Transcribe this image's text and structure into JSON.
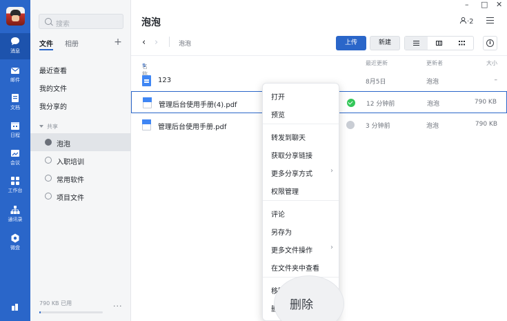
{
  "rail": {
    "items": [
      {
        "label": "消息",
        "icon": "chat-bubble-icon"
      },
      {
        "label": "邮件",
        "icon": "mail-icon"
      },
      {
        "label": "文档",
        "icon": "document-icon"
      },
      {
        "label": "日程",
        "icon": "calendar-icon"
      },
      {
        "label": "会议",
        "icon": "meeting-icon"
      },
      {
        "label": "工作台",
        "icon": "workbench-icon"
      },
      {
        "label": "通讯录",
        "icon": "contacts-icon"
      },
      {
        "label": "微盘",
        "icon": "drive-icon"
      }
    ]
  },
  "sidebar": {
    "search_placeholder": "搜索",
    "tabs": [
      "文件",
      "相册"
    ],
    "add": "+",
    "links": [
      "最近查看",
      "我的文件",
      "我分享的"
    ],
    "shared_header": "共享",
    "spaces": [
      "泡泡",
      "入职培训",
      "常用软件",
      "项目文件"
    ],
    "quota": "790 KB 已用",
    "quota_fraction": 0.02,
    "more": "···"
  },
  "header": {
    "title": "泡泡",
    "window": {
      "minimize": "–",
      "maximize": "□",
      "close": "✕"
    },
    "member_count": "·2",
    "breadcrumb": "泡泡",
    "upload": "上传",
    "new": "新建"
  },
  "table": {
    "columns": {
      "name": "名称",
      "modified": "最近更新",
      "updater": "更新者",
      "size": "大小"
    },
    "rows": [
      {
        "name": "123",
        "time": "8月5日",
        "owner": "泡泡",
        "size": "–"
      },
      {
        "name": "管理后台使用手册(4).pdf",
        "time": "12 分钟前",
        "owner": "泡泡",
        "size": "790 KB"
      },
      {
        "name": "管理后台使用手册.pdf",
        "time": "3 分钟前",
        "owner": "泡泡",
        "size": "790 KB"
      }
    ]
  },
  "context_menu": {
    "items": [
      "打开",
      "预览",
      "转发到聊天",
      "获取分享链接",
      "更多分享方式",
      "权限管理",
      "评论",
      "另存为",
      "更多文件操作",
      "在文件夹中查看",
      "移除",
      "删除"
    ]
  },
  "zoom_label": "删除",
  "colors": {
    "rail": "#2a66c9",
    "accent": "#2a66c9",
    "selection": "#2a66c9"
  }
}
